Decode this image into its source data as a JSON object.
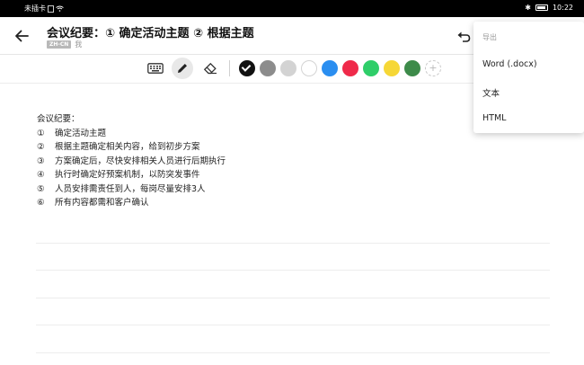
{
  "statusbar": {
    "carrier": "未插卡",
    "time": "10:22"
  },
  "header": {
    "title": "会议纪要：① 确定活动主题 ② 根据主题",
    "language_badge": "ZH-CN",
    "author": "我"
  },
  "toolbar": {
    "colors": [
      "#111111",
      "#8c8c8c",
      "#d3d3d3",
      "#ffffff",
      "#2a8ef0",
      "#ef2a4a",
      "#2fce69",
      "#f6d736",
      "#3d8b4a"
    ],
    "selected_color": "#111111",
    "add_color_label": "+"
  },
  "document": {
    "heading": "会议纪要：",
    "items": [
      {
        "num": "①",
        "text": "确定活动主题"
      },
      {
        "num": "②",
        "text": "根据主题确定相关内容，给到初步方案"
      },
      {
        "num": "③",
        "text": "方案确定后，尽快安排相关人员进行后期执行"
      },
      {
        "num": "④",
        "text": "执行时确定好预案机制，以防突发事件"
      },
      {
        "num": "⑤",
        "text": "人员安排需责任到人，每岗尽量安排3人"
      },
      {
        "num": "⑥",
        "text": "所有内容都需和客户确认"
      }
    ]
  },
  "export_menu": {
    "header": "导出",
    "items": [
      "Word (.docx)",
      "文本",
      "HTML"
    ]
  }
}
